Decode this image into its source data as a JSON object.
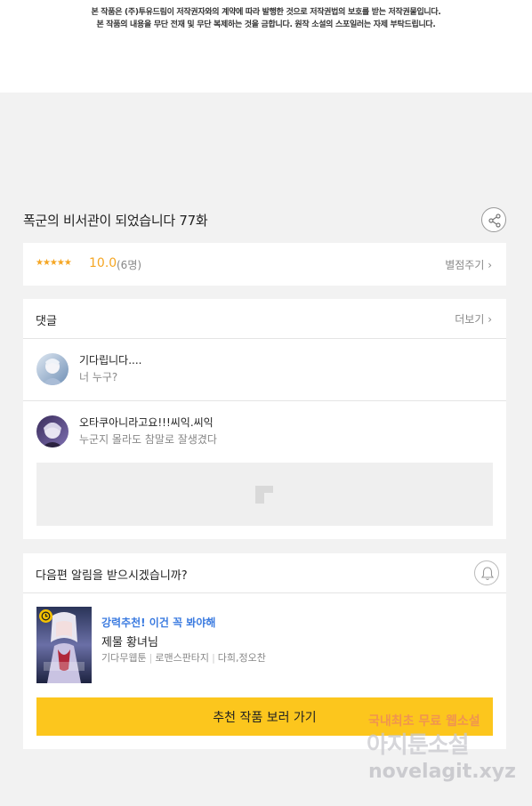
{
  "notice": {
    "line1": "본 작품은 (주)투유드림이 저작권자와의 계약에 따라 발행한 것으로 저작권법의 보호를 받는 저작권물입니다.",
    "line2": "본 작품의 내용을 무단 전재 및 무단 복제하는 것을 금합니다. 원작 소설의 스포일러는 자제 부탁드립니다."
  },
  "episode": {
    "title": "폭군의 비서관이 되었습니다 77화",
    "share_icon": "share-icon"
  },
  "rating": {
    "stars": "★★★★★",
    "score": "10.0",
    "count": "(6명)",
    "rate_link": "별점주기 ›"
  },
  "comments": {
    "title": "댓글",
    "more": "더보기 ›",
    "items": [
      {
        "name": "기다립니다....",
        "text": "너 누구?"
      },
      {
        "name": "오타쿠아니라고요!!!씨익.씨익",
        "text": "누군지 몰라도 참말로 잘생겼다"
      }
    ]
  },
  "notify": {
    "question": "다음편 알림을 받으시겠습니까?",
    "bell_icon": "bell-icon"
  },
  "recommendation": {
    "tag": "강력추천! 이건 꼭 봐야해",
    "name": "제물 황녀님",
    "meta": [
      "기다무웹툰",
      "로맨스판타지",
      "다희,정오찬"
    ],
    "button": "추천 작품 보러 가기"
  },
  "watermark": {
    "line1": "국내최초 무료 웹소설",
    "line2": "아지툰소설",
    "line3": "novelagit.xyz"
  },
  "colors": {
    "accent": "#fcc61d",
    "star": "#f5a623",
    "tag_blue": "#3b7be0"
  }
}
